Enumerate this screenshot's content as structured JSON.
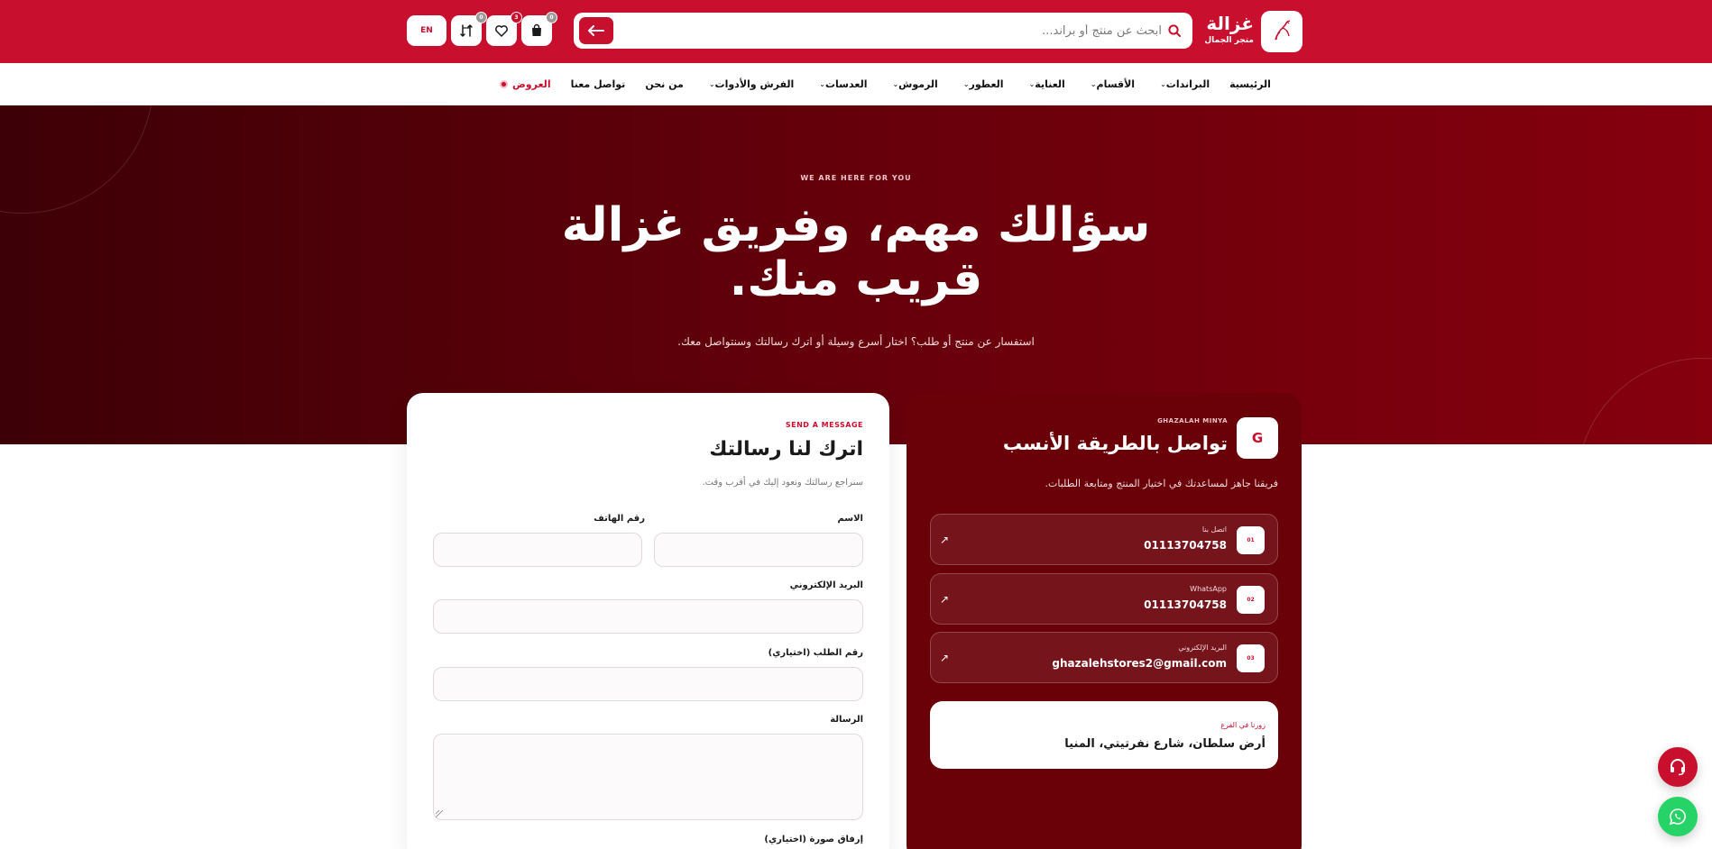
{
  "header": {
    "brand_name": "غزالة",
    "brand_tagline": "متجر الجمال",
    "search_placeholder": "ابحث عن منتج أو براند...",
    "cart_count": "0",
    "wishlist_count": "3",
    "compare_count": "0",
    "lang_label": "EN",
    "colors": {
      "primary": "#c8102e",
      "hero_dark": "#3d0006",
      "hero_light": "#86000e",
      "whatsapp": "#25d366"
    }
  },
  "nav": {
    "items": [
      {
        "label": "الرئيسية",
        "dropdown": false
      },
      {
        "label": "البراندات",
        "dropdown": true
      },
      {
        "label": "الأقسام",
        "dropdown": true
      },
      {
        "label": "العناية",
        "dropdown": true
      },
      {
        "label": "العطور",
        "dropdown": true
      },
      {
        "label": "الرموش",
        "dropdown": true
      },
      {
        "label": "العدسات",
        "dropdown": true
      },
      {
        "label": "الفرش والأدوات",
        "dropdown": true
      },
      {
        "label": "من نحن",
        "dropdown": false
      },
      {
        "label": "تواصل معنا",
        "dropdown": false
      }
    ],
    "offers_label": "العروض"
  },
  "hero": {
    "eyebrow": "WE ARE HERE FOR YOU",
    "title": "سؤالك مهم، وفريق غزالة قريب منك.",
    "subtitle": "استفسار عن منتج أو طلب؟ اختار أسرع وسيلة أو اترك رسالتك وسنتواصل معك."
  },
  "form": {
    "eyebrow": "SEND A MESSAGE",
    "title": "اترك لنا رسالتك",
    "subtitle": "سنراجع رسالتك ونعود إليك في أقرب وقت.",
    "name_label": "الاسم",
    "phone_label": "رقم الهاتف",
    "email_label": "البريد الإلكتروني",
    "order_label": "رقم الطلب (اختياري)",
    "message_label": "الرسالة",
    "image_label": "إرفاق صورة (اختياري)"
  },
  "contact": {
    "logo_letter": "G",
    "eyebrow": "GHAZALAH MINYA",
    "title": "تواصل بالطريقة الأنسب",
    "subtitle": "فريقنا جاهز لمساعدتك في اختيار المنتج ومتابعة الطلبات.",
    "items": [
      {
        "num": "01",
        "label": "اتصل بنا",
        "value": "01113704758"
      },
      {
        "num": "02",
        "label": "WhatsApp",
        "value": "01113704758"
      },
      {
        "num": "03",
        "label": "البريد الإلكتروني",
        "value": "ghazalehstores2@gmail.com"
      }
    ],
    "branch_label": "زورنا في الفرع",
    "branch_value": "أرض سلطان، شارع نفرتيتي، المنيا"
  }
}
